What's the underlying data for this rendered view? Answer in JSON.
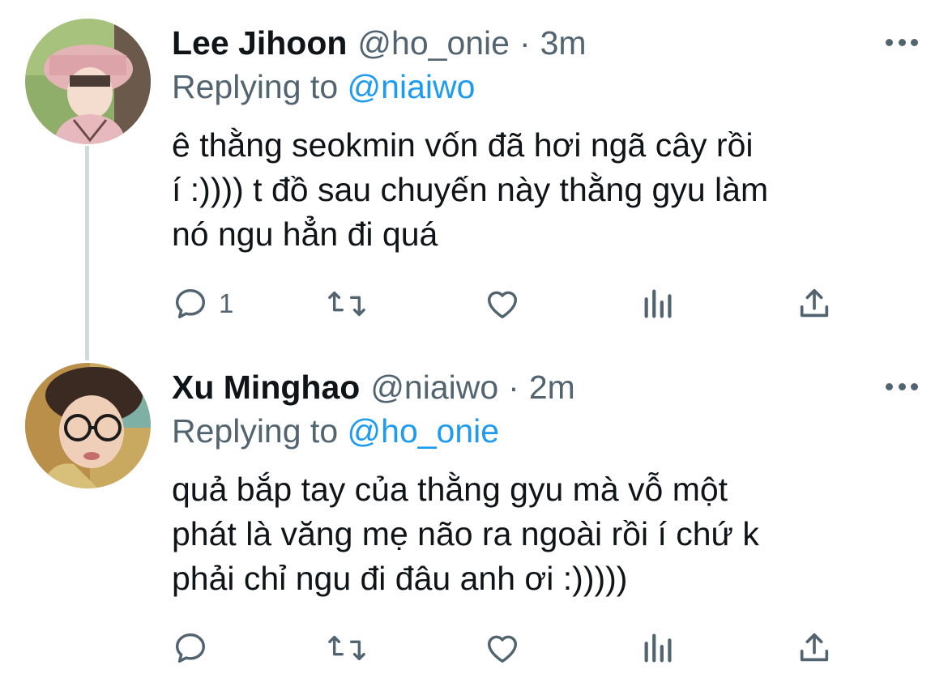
{
  "tweets": [
    {
      "author_name": "Lee Jihoon",
      "author_handle": "@ho_onie",
      "separator": "·",
      "time": "3m",
      "replying_prefix": "Replying to",
      "replying_to": "@niaiwo",
      "text_lines": [
        "ê thằng seokmin vốn đã hơi ngã cây rồi",
        "í :)))) t đồ sau chuyến này thằng gyu làm",
        "nó ngu hẳn đi quá"
      ],
      "reply_count": "1",
      "icons": [
        "reply-icon",
        "retweet-icon",
        "like-icon",
        "views-icon",
        "share-icon",
        "more-icon"
      ]
    },
    {
      "author_name": "Xu Minghao",
      "author_handle": "@niaiwo",
      "separator": "·",
      "time": "2m",
      "replying_prefix": "Replying to",
      "replying_to": "@ho_onie",
      "text_lines": [
        "quả bắp tay của thằng gyu mà vỗ một",
        "phát là văng mẹ não ra ngoài rồi í chứ k",
        "phải chỉ ngu đi đâu anh ơi :)))))"
      ],
      "reply_count": "",
      "icons": [
        "reply-icon",
        "retweet-icon",
        "like-icon",
        "views-icon",
        "share-icon",
        "more-icon"
      ]
    }
  ],
  "colors": {
    "text_primary": "#0f1419",
    "text_secondary": "#536471",
    "mention": "#1d9bf0",
    "thread_line": "#cfd9de"
  }
}
